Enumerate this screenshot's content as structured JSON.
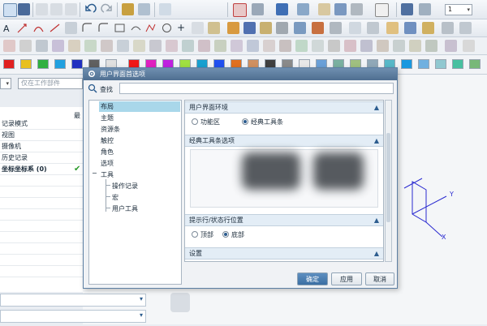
{
  "toolbar": {
    "step_value": "1",
    "filter_placeholder": "仅在工作部件"
  },
  "palette": [
    "#e02020",
    "#e8c020",
    "#30b040",
    "#20a0e0",
    "#2030c0",
    "#606060",
    "#e0e0e0",
    "#f01818",
    "#e020c0",
    "#c020e0",
    "#a0e040",
    "#18a0d0",
    "#2050f0",
    "#e07020",
    "#d09060",
    "#404040",
    "#8a8a8a",
    "#e8e8e8",
    "#6aa0d8",
    "#7ab0a0",
    "#a0c080",
    "#90a8b8",
    "#58b8c8",
    "#1898e0",
    "#70b0e0",
    "#90c8d0",
    "#48c0a0",
    "#78b878"
  ],
  "navigator": {
    "rows": [
      "记录模式",
      "视图",
      "摄像机",
      "历史记录",
      "坐标坐标系 (0)"
    ],
    "check": "✔",
    "col_header": "最"
  },
  "dialog": {
    "title": "用户界面首选项",
    "find_label": "查找",
    "tree": [
      "布局",
      "主题",
      "资源条",
      "触控",
      "角色",
      "选项",
      "工具",
      "操作记录",
      "宏",
      "用户工具"
    ],
    "sections": {
      "ui_env": {
        "title": "用户界面环境",
        "options": [
          "功能区",
          "经典工具条"
        ]
      },
      "classic": {
        "title": "经典工具条选项"
      },
      "hint": {
        "title": "提示行/状态行位置",
        "options": [
          "顶部",
          "底部"
        ]
      },
      "settings": {
        "title": "设置"
      }
    },
    "buttons": {
      "ok": "确定",
      "apply": "应用",
      "cancel": "取消"
    }
  },
  "axes": {
    "y": "Y",
    "x": "X"
  }
}
